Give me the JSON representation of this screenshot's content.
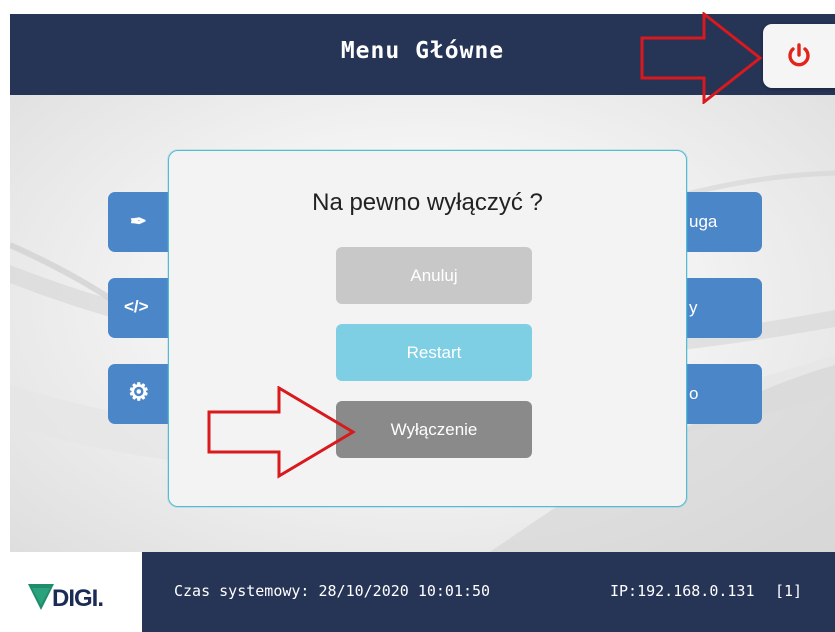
{
  "header": {
    "title": "Menu Główne",
    "power_icon": "power-icon"
  },
  "menu_tiles": [
    {
      "icon": "feather-icon",
      "glyph": "✒",
      "label": ""
    },
    {
      "icon": "code-icon",
      "glyph": "</>",
      "label": ""
    },
    {
      "icon": "gear-icon",
      "glyph": "⚙",
      "label": ""
    },
    {
      "icon": "",
      "glyph": "",
      "label": "uga"
    },
    {
      "icon": "",
      "glyph": "",
      "label": "y"
    },
    {
      "icon": "",
      "glyph": "",
      "label": "o"
    }
  ],
  "dialog": {
    "title": "Na pewno wyłączyć ?",
    "cancel_label": "Anuluj",
    "restart_label": "Restart",
    "shutdown_label": "Wyłączenie"
  },
  "footer": {
    "logo_text": "DIGI.",
    "system_time": "Czas systemowy: 28/10/2020 10:01:50",
    "ip": "IP:192.168.0.131",
    "screen_id": "[1]"
  },
  "colors": {
    "header_bg": "#263456",
    "tile_blue": "#4a86c8",
    "dialog_border": "#52bcd2",
    "power_red": "#e3241b",
    "annotation_red": "#d8191e"
  }
}
